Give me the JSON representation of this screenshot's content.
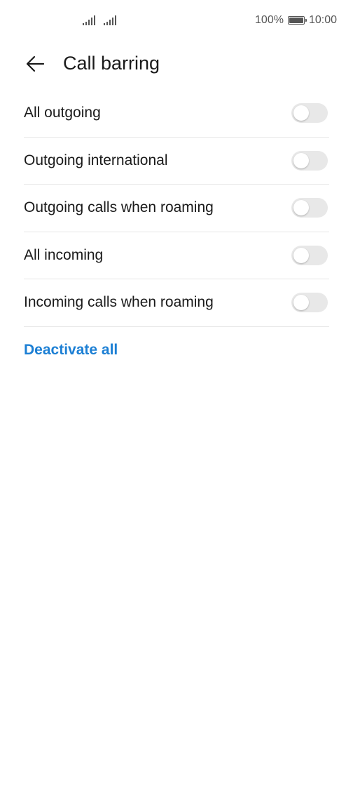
{
  "status_bar": {
    "battery_text": "100%",
    "time": "10:00",
    "battery_level": 1.0
  },
  "header": {
    "title": "Call barring",
    "back_icon": "arrow-left-icon"
  },
  "items": [
    {
      "label": "All outgoing",
      "enabled": false
    },
    {
      "label": "Outgoing international",
      "enabled": false
    },
    {
      "label": "Outgoing calls when roaming",
      "enabled": false
    },
    {
      "label": "All incoming",
      "enabled": false
    },
    {
      "label": "Incoming calls when roaming",
      "enabled": false
    }
  ],
  "actions": {
    "deactivate_all": "Deactivate all"
  },
  "colors": {
    "accent": "#1c7fd4",
    "toggle_off": "#e8e8e8",
    "divider": "#e6e6e6"
  }
}
